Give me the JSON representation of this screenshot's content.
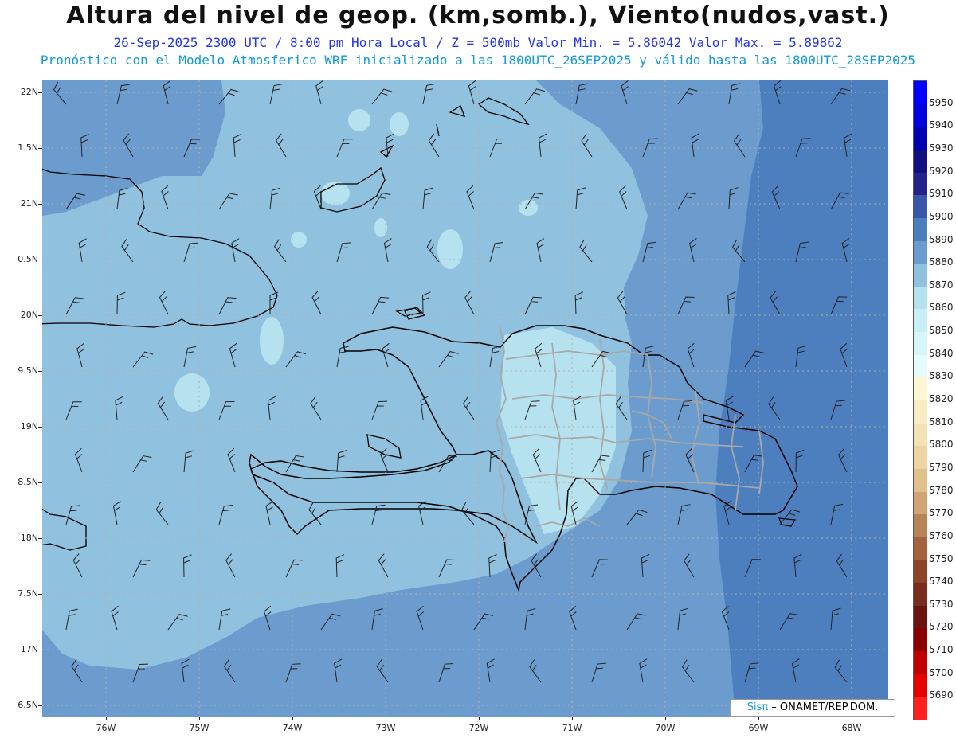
{
  "header": {
    "title": "Altura del nivel de geop. (km,somb.), Viento(nudos,vast.)",
    "subtitle": "26-Sep-2025  2300 UTC / 8:00 pm Hora Local / Z = 500mb    Valor Min. = 5.86042  Valor Max. = 5.89862",
    "info": "Pronóstico con el Modelo Atmosferico WRF inicializado a las 1800UTC_26SEP2025 y válido hasta las  1800UTC_28SEP2025"
  },
  "axes": {
    "lat_labels": [
      "22N",
      "1.5N",
      "21N",
      "0.5N",
      "20N",
      "9.5N",
      "19N",
      "8.5N",
      "18N",
      "7.5N",
      "17N",
      "6.5N"
    ],
    "lon_labels": [
      "76W",
      "75W",
      "74W",
      "73W",
      "72W",
      "71W",
      "70W",
      "69W",
      "68W"
    ]
  },
  "colorbar": {
    "labels": [
      "5950",
      "5940",
      "5930",
      "5920",
      "5910",
      "5900",
      "5890",
      "5880",
      "5870",
      "5860",
      "5850",
      "5840",
      "5830",
      "5820",
      "5810",
      "5800",
      "5790",
      "5780",
      "5770",
      "5760",
      "5750",
      "5740",
      "5730",
      "5720",
      "5710",
      "5700",
      "5690"
    ],
    "colors": [
      "#0000ff",
      "#0000dd",
      "#0000b0",
      "#10107e",
      "#22228a",
      "#3a56a8",
      "#4d7fbf",
      "#6b9ccd",
      "#90c1df",
      "#b6e2ef",
      "#c8eef6",
      "#d8f5fa",
      "#e6fbfd",
      "#fdf6d2",
      "#f8ecc4",
      "#f3e2b6",
      "#eed4a2",
      "#e2c08c",
      "#d0a474",
      "#b98358",
      "#a4623f",
      "#8e442b",
      "#7a2b1d",
      "#6a1310",
      "#8a0000",
      "#c00000",
      "#e60000",
      "#ff2020"
    ]
  },
  "credit": {
    "logo": "Sisπ",
    "text": " – ONAMET/REP.DOM."
  },
  "colors": {
    "dark_band": "#4d7fbf",
    "mid_band": "#6b9ccd",
    "light_band": "#90c1df",
    "lightest_band": "#b6e2ef",
    "coast": "#000000",
    "province_border": "#a8a8a8"
  }
}
